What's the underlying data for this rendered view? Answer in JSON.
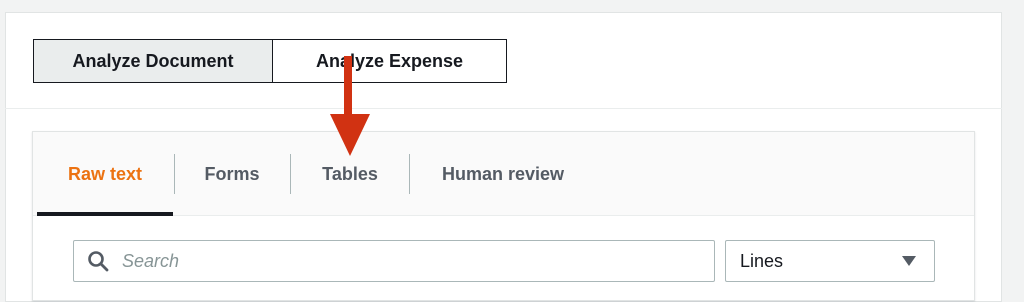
{
  "mode_toggle": {
    "analyze_document_label": "Analyze Document",
    "analyze_expense_label": "Analyze Expense"
  },
  "tabs": [
    {
      "label": "Raw text",
      "active": true
    },
    {
      "label": "Forms",
      "active": false
    },
    {
      "label": "Tables",
      "active": false
    },
    {
      "label": "Human review",
      "active": false
    }
  ],
  "search": {
    "placeholder": "Search",
    "value": ""
  },
  "granularity_select": {
    "selected": "Lines"
  },
  "icons": {
    "search": "search-icon",
    "dropdown": "caret-down-icon",
    "annotation": "red-arrow-down-icon"
  },
  "colors": {
    "active_tab": "#ec7211",
    "annotation_arrow": "#d13212",
    "active_toggle_bg": "#eaeded"
  }
}
